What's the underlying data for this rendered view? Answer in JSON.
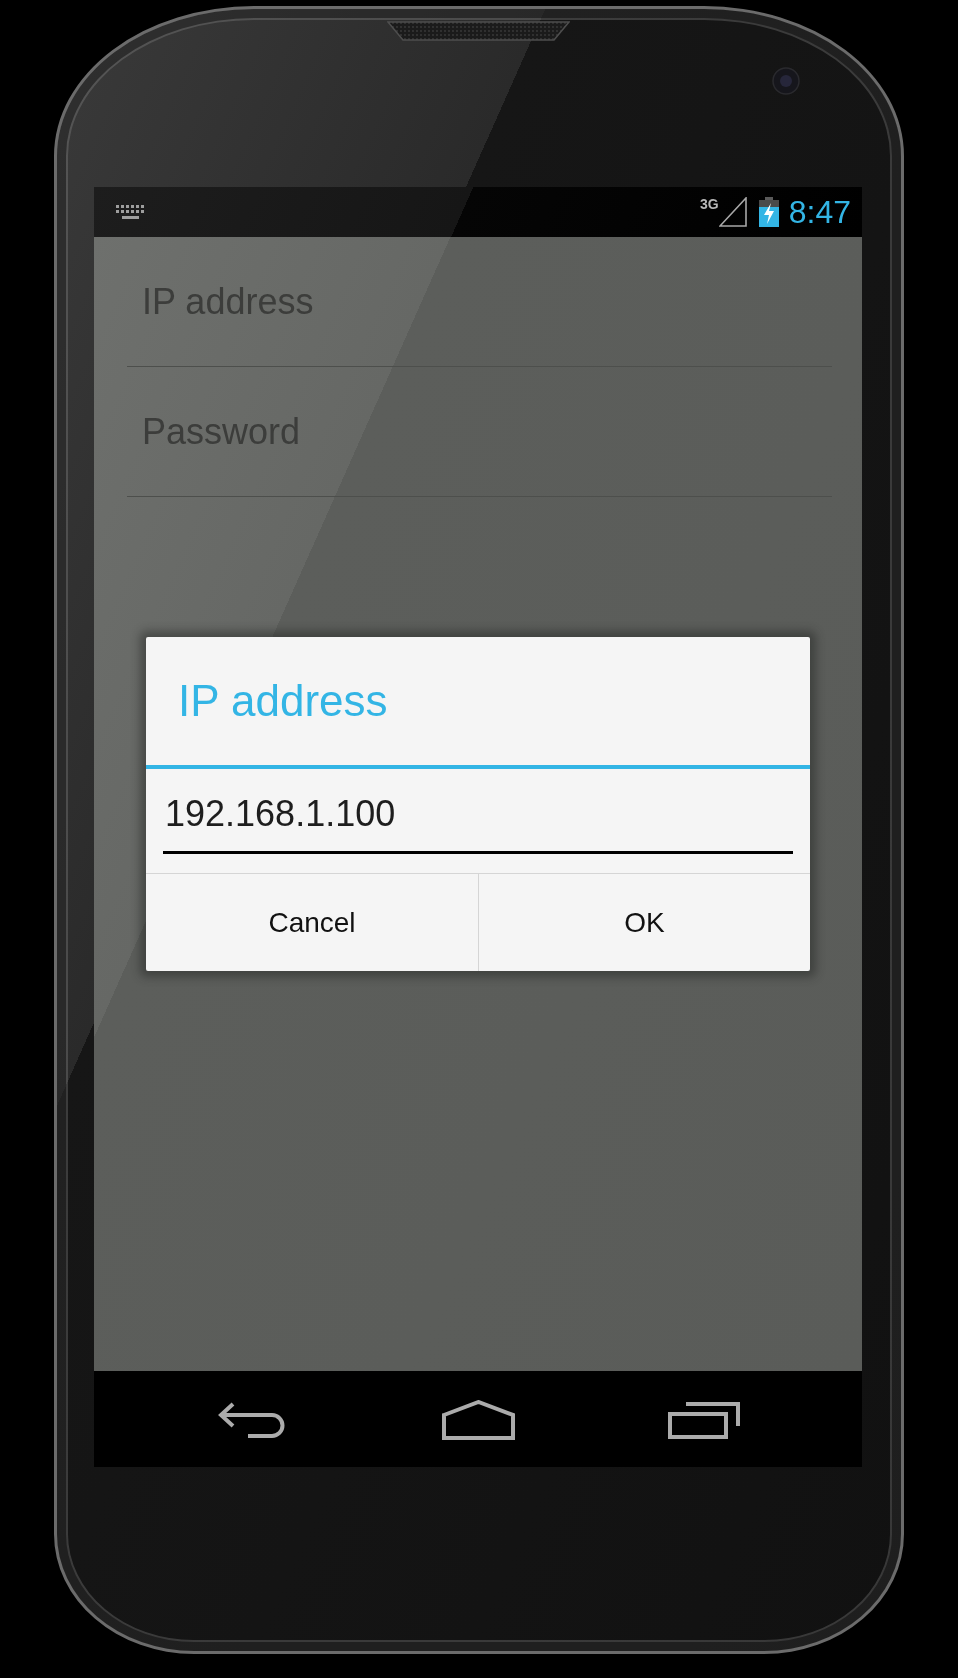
{
  "status_bar": {
    "network_type": "3G",
    "time": "8:47"
  },
  "settings_list": [
    {
      "title": "IP address"
    },
    {
      "title": "Password"
    }
  ],
  "dialog": {
    "title": "IP address",
    "field": {
      "value": "192.168.1.100"
    },
    "buttons": [
      {
        "label": "Cancel"
      },
      {
        "label": "OK"
      }
    ]
  }
}
